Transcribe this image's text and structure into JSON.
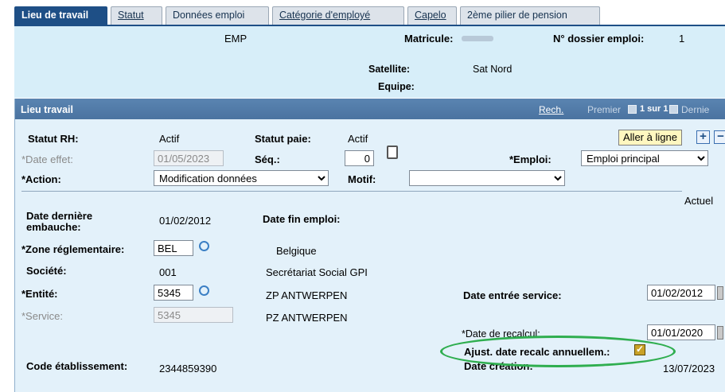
{
  "tabs": [
    {
      "label": "Lieu de travail"
    },
    {
      "label": "Statut"
    },
    {
      "label": "Données emploi"
    },
    {
      "label": "Catégorie d'employé"
    },
    {
      "label": "Capelo"
    },
    {
      "label": "2ème pilier de pension"
    }
  ],
  "header": {
    "emp": "EMP",
    "matricule_label": "Matricule:",
    "dossier_label": "N° dossier emploi:",
    "dossier_value": "1",
    "satellite_label": "Satellite:",
    "satellite_value": "Sat Nord",
    "equipe_label": "Equipe:"
  },
  "panel": {
    "title": "Lieu travail",
    "search_link": "Rech.",
    "first_link": "Premier",
    "page_info": "1 sur 1",
    "last_link": "Dernie",
    "goto_button": "Aller à ligne",
    "add_symbol": "+",
    "remove_symbol": "−"
  },
  "fields": {
    "statut_rh_label": "Statut RH:",
    "statut_rh_value": "Actif",
    "statut_paie_label": "Statut paie:",
    "statut_paie_value": "Actif",
    "date_effet_label": "*Date effet:",
    "date_effet_value": "01/05/2023",
    "seq_label": "Séq.:",
    "seq_value": "0",
    "emploi_label": "*Emploi:",
    "emploi_value": "Emploi principal",
    "action_label": "*Action:",
    "action_value": "Modification données",
    "motif_label": "Motif:",
    "motif_value": "",
    "actuel": "Actuel",
    "date_embauche_label": "Date dernière embauche:",
    "date_embauche_value": "01/02/2012",
    "date_fin_label": "Date fin emploi:",
    "zone_label": "*Zone réglementaire:",
    "zone_value": "BEL",
    "zone_desc": "Belgique",
    "societe_label": "Société:",
    "societe_value": "001",
    "societe_desc": "Secrétariat Social GPI",
    "entite_label": "*Entité:",
    "entite_value": "5345",
    "entite_desc": "ZP ANTWERPEN",
    "service_label": "*Service:",
    "service_value": "5345",
    "service_desc": "PZ ANTWERPEN",
    "date_entree_label": "Date entrée service:",
    "date_entree_value": "01/02/2012",
    "date_recalcul_label": "*Date de recalcul:",
    "date_recalcul_value": "01/01/2020",
    "ajust_label": "Ajust. date recalc annuellem.:",
    "date_creation_label": "Date création:",
    "date_creation_value": "13/07/2023",
    "code_etab_label": "Code établissement:",
    "code_etab_value": "2344859390"
  },
  "colors": {
    "tab_active": "#1e4f86",
    "header_band": "#d7eef9",
    "panel_bg": "#e3f1fa",
    "highlight_oval": "#2fae4f"
  }
}
